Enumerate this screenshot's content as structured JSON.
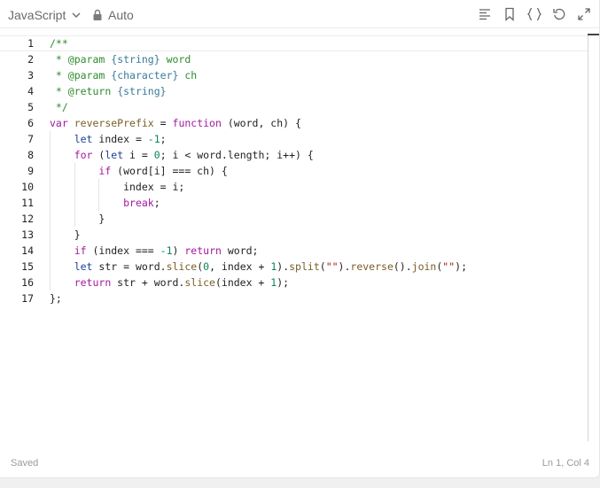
{
  "toolbar": {
    "language": "JavaScript",
    "mode": "Auto",
    "icons": [
      "format-icon",
      "bookmark-icon",
      "braces-icon",
      "reset-icon",
      "expand-icon"
    ]
  },
  "editor": {
    "lines": [
      [
        [
          "c",
          "/**"
        ]
      ],
      [
        [
          "c",
          " * "
        ],
        [
          "d",
          "@param"
        ],
        [
          "c",
          " "
        ],
        [
          "t",
          "{string}"
        ],
        [
          "c",
          " word"
        ]
      ],
      [
        [
          "c",
          " * "
        ],
        [
          "d",
          "@param"
        ],
        [
          "c",
          " "
        ],
        [
          "t",
          "{character}"
        ],
        [
          "c",
          " ch"
        ]
      ],
      [
        [
          "c",
          " * "
        ],
        [
          "d",
          "@return"
        ],
        [
          "c",
          " "
        ],
        [
          "t",
          "{string}"
        ]
      ],
      [
        [
          "c",
          " */"
        ]
      ],
      [
        [
          "k",
          "var"
        ],
        [
          "p",
          " "
        ],
        [
          "f",
          "reversePrefix"
        ],
        [
          "p",
          " = "
        ],
        [
          "k",
          "function"
        ],
        [
          "p",
          " (word, ch) {"
        ]
      ],
      [
        [
          "p",
          "    "
        ],
        [
          "v",
          "let"
        ],
        [
          "p",
          " index = "
        ],
        [
          "n",
          "-1"
        ],
        [
          "p",
          ";"
        ]
      ],
      [
        [
          "p",
          "    "
        ],
        [
          "k",
          "for"
        ],
        [
          "p",
          " ("
        ],
        [
          "v",
          "let"
        ],
        [
          "p",
          " i = "
        ],
        [
          "n",
          "0"
        ],
        [
          "p",
          "; i < word.length; i++) {"
        ]
      ],
      [
        [
          "p",
          "        "
        ],
        [
          "k",
          "if"
        ],
        [
          "p",
          " (word[i] === ch) {"
        ]
      ],
      [
        [
          "p",
          "            index = i;"
        ]
      ],
      [
        [
          "p",
          "            "
        ],
        [
          "k",
          "break"
        ],
        [
          "p",
          ";"
        ]
      ],
      [
        [
          "p",
          "        }"
        ]
      ],
      [
        [
          "p",
          "    }"
        ]
      ],
      [
        [
          "p",
          "    "
        ],
        [
          "k",
          "if"
        ],
        [
          "p",
          " (index === "
        ],
        [
          "n",
          "-1"
        ],
        [
          "p",
          ") "
        ],
        [
          "k",
          "return"
        ],
        [
          "p",
          " word;"
        ]
      ],
      [
        [
          "p",
          "    "
        ],
        [
          "v",
          "let"
        ],
        [
          "p",
          " str = word."
        ],
        [
          "f",
          "slice"
        ],
        [
          "p",
          "("
        ],
        [
          "n",
          "0"
        ],
        [
          "p",
          ", index + "
        ],
        [
          "n",
          "1"
        ],
        [
          "p",
          ")."
        ],
        [
          "f",
          "split"
        ],
        [
          "p",
          "("
        ],
        [
          "s",
          "\"\""
        ],
        [
          "p",
          ")."
        ],
        [
          "f",
          "reverse"
        ],
        [
          "p",
          "()."
        ],
        [
          "f",
          "join"
        ],
        [
          "p",
          "("
        ],
        [
          "s",
          "\"\""
        ],
        [
          "p",
          ");"
        ]
      ],
      [
        [
          "p",
          "    "
        ],
        [
          "k",
          "return"
        ],
        [
          "p",
          " str + word."
        ],
        [
          "f",
          "slice"
        ],
        [
          "p",
          "(index + "
        ],
        [
          "n",
          "1"
        ],
        [
          "p",
          ");"
        ]
      ],
      [
        [
          "p",
          "};"
        ]
      ]
    ]
  },
  "status": {
    "saved": "Saved",
    "position": "Ln 1, Col 4"
  }
}
